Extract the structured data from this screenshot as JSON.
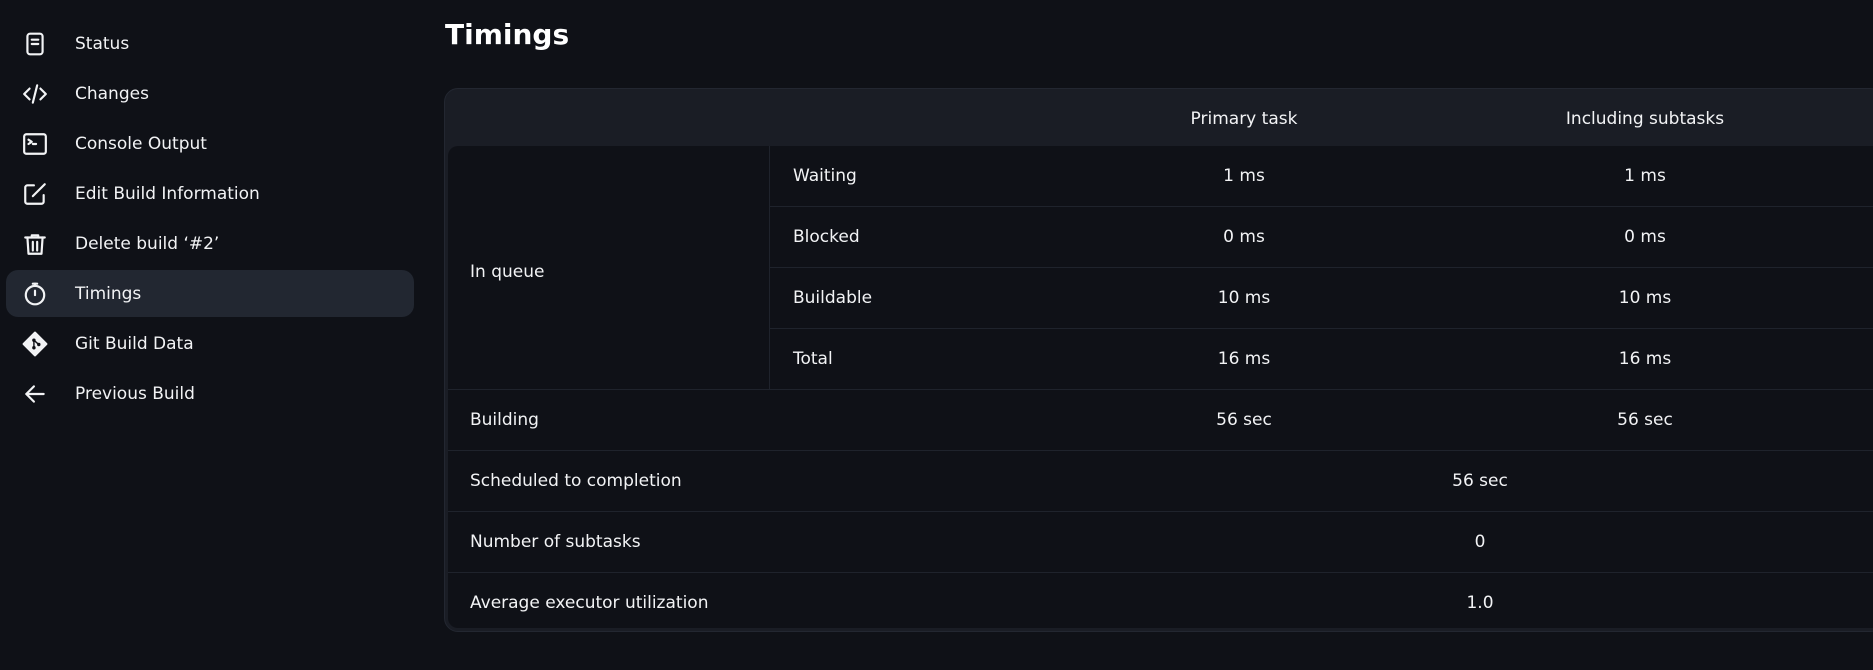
{
  "sidebar": {
    "items": [
      {
        "label": "Status",
        "icon": "document-icon"
      },
      {
        "label": "Changes",
        "icon": "code-icon"
      },
      {
        "label": "Console Output",
        "icon": "terminal-icon"
      },
      {
        "label": "Edit Build Information",
        "icon": "edit-icon"
      },
      {
        "label": "Delete build ‘#2’",
        "icon": "trash-icon"
      },
      {
        "label": "Timings",
        "icon": "stopwatch-icon",
        "active": true
      },
      {
        "label": "Git Build Data",
        "icon": "git-icon"
      },
      {
        "label": "Previous Build",
        "icon": "arrow-left-icon"
      }
    ]
  },
  "page": {
    "title": "Timings"
  },
  "table": {
    "headers": {
      "primary": "Primary task",
      "subtasks": "Including subtasks"
    },
    "in_queue": {
      "label": "In queue",
      "rows": [
        {
          "label": "Waiting",
          "primary": "1 ms",
          "subtasks": "1 ms"
        },
        {
          "label": "Blocked",
          "primary": "0 ms",
          "subtasks": "0 ms"
        },
        {
          "label": "Buildable",
          "primary": "10 ms",
          "subtasks": "10 ms"
        },
        {
          "label": "Total",
          "primary": "16 ms",
          "subtasks": "16 ms"
        }
      ]
    },
    "building": {
      "label": "Building",
      "primary": "56 sec",
      "subtasks": "56 sec"
    },
    "scheduled": {
      "label": "Scheduled to completion",
      "value": "56 sec"
    },
    "subtask_count": {
      "label": "Number of subtasks",
      "value": "0"
    },
    "utilization": {
      "label": "Average executor utilization",
      "value": "1.0"
    }
  }
}
